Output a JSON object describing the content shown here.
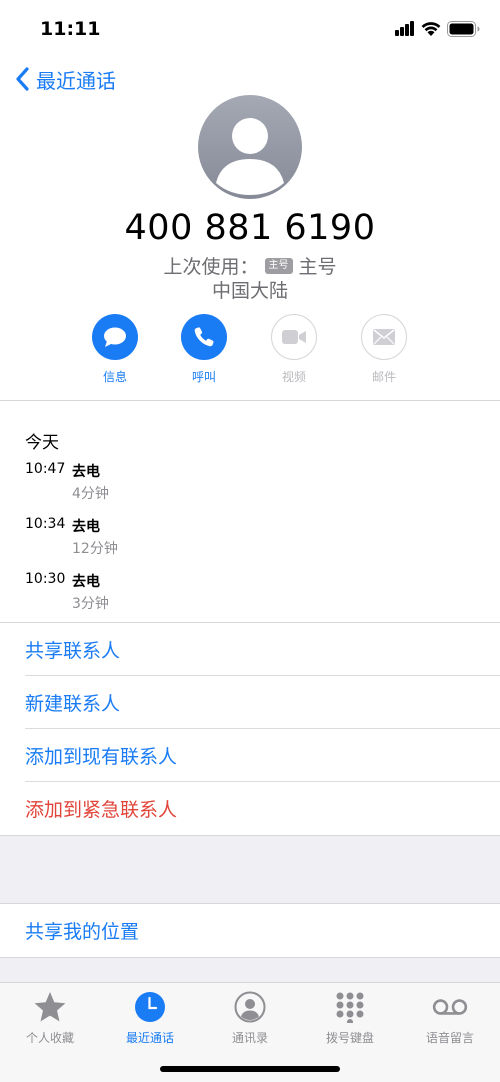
{
  "status_bar": {
    "time": "11:11"
  },
  "nav": {
    "back_label": "最近通话"
  },
  "contact": {
    "number": "400 881 6190",
    "last_used_label": "上次使用：",
    "sim_badge": "主号",
    "sim_name": "主号",
    "region": "中国大陆"
  },
  "actions": [
    {
      "label": "信息",
      "icon": "message-icon",
      "enabled": true
    },
    {
      "label": "呼叫",
      "icon": "phone-icon",
      "enabled": true
    },
    {
      "label": "视频",
      "icon": "video-icon",
      "enabled": false
    },
    {
      "label": "邮件",
      "icon": "mail-icon",
      "enabled": false
    }
  ],
  "calls": {
    "day": "今天",
    "items": [
      {
        "time": "10:47",
        "type": "去电",
        "duration": "4分钟"
      },
      {
        "time": "10:34",
        "type": "去电",
        "duration": "12分钟"
      },
      {
        "time": "10:30",
        "type": "去电",
        "duration": "3分钟"
      }
    ]
  },
  "options": {
    "share_contact": "共享联系人",
    "new_contact": "新建联系人",
    "add_existing": "添加到现有联系人",
    "add_emergency": "添加到紧急联系人",
    "share_location": "共享我的位置"
  },
  "tabs": [
    {
      "label": "个人收藏",
      "icon": "star-icon",
      "active": false
    },
    {
      "label": "最近通话",
      "icon": "clock-icon",
      "active": true
    },
    {
      "label": "通讯录",
      "icon": "person-icon",
      "active": false
    },
    {
      "label": "拨号键盘",
      "icon": "keypad-icon",
      "active": false
    },
    {
      "label": "语音留言",
      "icon": "voicemail-icon",
      "active": false
    }
  ],
  "colors": {
    "accent": "#1a7cf5",
    "danger": "#e2443a",
    "secondary_text": "#8e8e93"
  }
}
